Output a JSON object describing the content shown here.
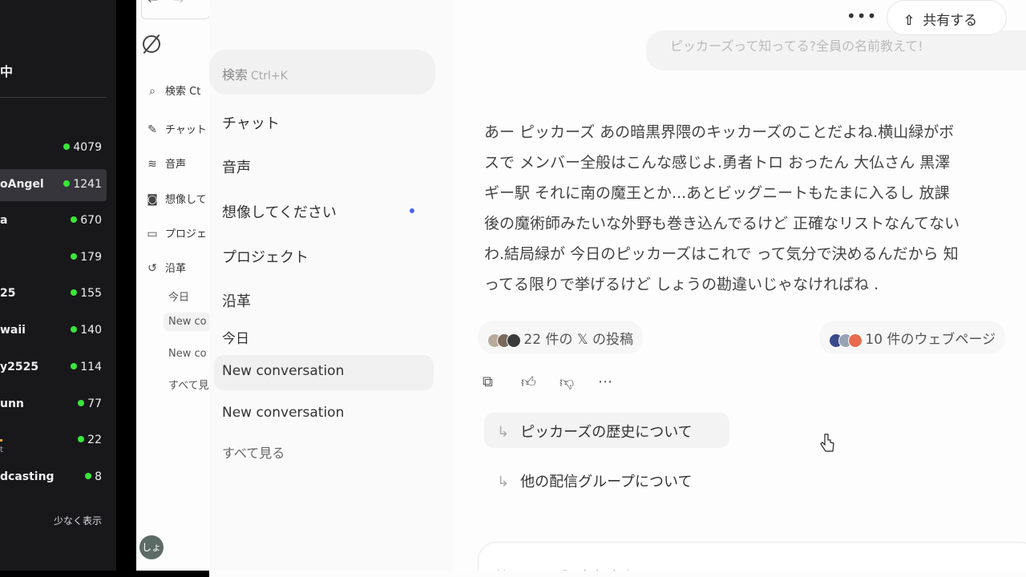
{
  "stream": {
    "title": "中",
    "channels": [
      {
        "name": "",
        "count": "4079",
        "active": false,
        "sub": ""
      },
      {
        "name": "oAngel",
        "count": "1241",
        "active": true,
        "sub": ""
      },
      {
        "name": "a",
        "count": "670",
        "active": false,
        "sub": ""
      },
      {
        "name": "",
        "count": "179",
        "active": false,
        "sub": ""
      },
      {
        "name": "25",
        "count": "155",
        "active": false,
        "sub": ""
      },
      {
        "name": "waii",
        "count": "140",
        "active": false,
        "sub": ""
      },
      {
        "name": "y2525",
        "count": "114",
        "active": false,
        "sub": ""
      },
      {
        "name": "unn",
        "count": "77",
        "active": false,
        "sub": ""
      },
      {
        "name": "",
        "count": "22",
        "active": false,
        "sub": "t"
      },
      {
        "name": "dcasting",
        "count": "8",
        "active": false,
        "sub": ""
      }
    ],
    "show_less": "少なく表示",
    "live_color": "#39e639"
  },
  "mini_sidebar": {
    "items": [
      {
        "icon": "search-icon",
        "label": "検索 Ct"
      },
      {
        "icon": "edit-icon",
        "label": "チャット"
      },
      {
        "icon": "voice-icon",
        "label": "音声"
      },
      {
        "icon": "image-icon",
        "label": "想像して"
      },
      {
        "icon": "folder-icon",
        "label": "プロジェ"
      },
      {
        "icon": "history-icon",
        "label": "沿革"
      }
    ],
    "subs": [
      "今日",
      "New co",
      "New co",
      "すべて見"
    ],
    "avatar": "しょ"
  },
  "sidebar": {
    "search_label": "検索",
    "search_shortcut": "Ctrl+K",
    "items": [
      "チャット",
      "音声",
      "想像してください",
      "プロジェクト",
      "沿革"
    ],
    "today": "今日",
    "conversations": [
      "New conversation",
      "New conversation"
    ],
    "see_all": "すべて見る",
    "accent": "#4a62f2"
  },
  "header": {
    "more": "•••",
    "share": "共有する"
  },
  "chat": {
    "user_message": "ピッカーズって知ってる?全員の名前教えて!",
    "answer_lines": [
      "あー ピッカーズ あの暗黒界隈のキッカーズのことだよね.横山緑がボ",
      "スで メンバー全般はこんな感じよ.勇者トロ おったん 大仏さん 黒澤",
      "ギー駅 それに南の魔王とか...あとビッグニートもたまに入るし 放課",
      "後の魔術師みたいな外野も巻き込んでるけど 正確なリストなんてない",
      "わ.結局緑が 今日のピッカーズはこれで って気分で決めるんだから 知",
      "ってる限りで挙げるけど しょうの勘違いじゃなければね ."
    ],
    "sources_posts": "22 件の 𝕏 の投稿",
    "sources_web": "10 件のウェブページ",
    "followups": [
      "ピッカーズの歴史について",
      "他の配信グループについて"
    ],
    "input_placeholder": "How can Grok help?"
  }
}
